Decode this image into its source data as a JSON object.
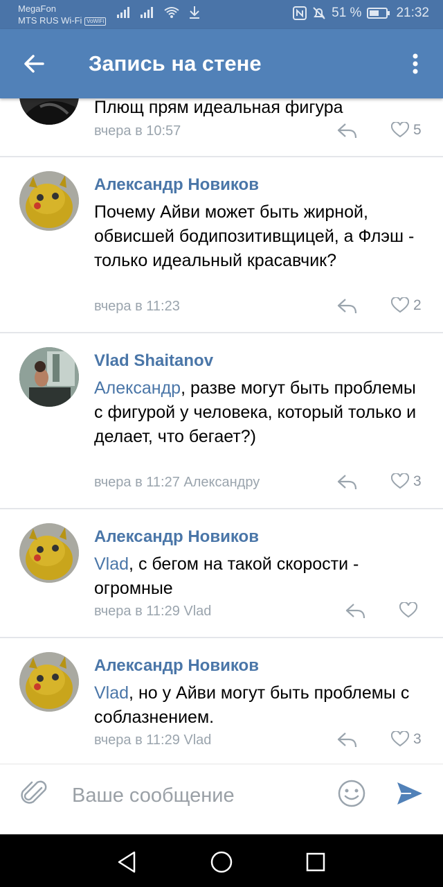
{
  "status_bar": {
    "carrier1": "MegaFon",
    "carrier2": "MTS RUS Wi-Fi",
    "wifi_tag": "VoWiFi",
    "battery": "51 %",
    "time": "21:32"
  },
  "header": {
    "title": "Запись на стене"
  },
  "comments": [
    {
      "author": "",
      "text": "Плющ прям идеальная фигура",
      "mention": "",
      "meta": "вчера в 10:57",
      "likes": "5"
    },
    {
      "author": "Александр Новиков",
      "mention": "",
      "text": "Почему Айви может быть жирной, обвисшей бодипозитивщицей, а Флэш - только идеальный красавчик?",
      "meta": "вчера в 11:23",
      "likes": "2"
    },
    {
      "author": "Vlad Shaitanov",
      "mention": "Александр",
      "text": ", разве могут быть проблемы с фигурой у человека, который только и делает, что бегает?)",
      "meta": "вчера в 11:27 Александру",
      "likes": "3"
    },
    {
      "author": "Александр Новиков",
      "mention": "Vlad",
      "text": ", с бегом на такой скорости - огромные",
      "meta": "вчера в 11:29 Vlad",
      "likes": ""
    },
    {
      "author": "Александр Новиков",
      "mention": "Vlad",
      "text": ", но у Айви могут быть проблемы с соблазнением.",
      "meta": "вчера в 11:29 Vlad",
      "likes": "3"
    }
  ],
  "composer": {
    "placeholder": "Ваше сообщение"
  },
  "colors": {
    "header": "#5181b8",
    "link": "#4a76a8",
    "meta": "#9aa4ad"
  }
}
